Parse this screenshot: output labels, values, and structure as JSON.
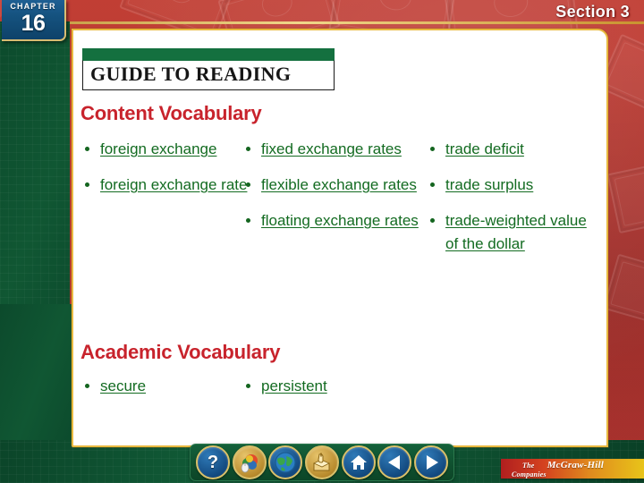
{
  "chapter_badge": {
    "label": "CHAPTER",
    "number": "16"
  },
  "header": {
    "section_title": "Section 3"
  },
  "guide_box": {
    "title": "GUIDE TO READING"
  },
  "content_vocabulary": {
    "heading": "Content Vocabulary",
    "columns": [
      {
        "terms": [
          "foreign exchange",
          "foreign exchange rate"
        ]
      },
      {
        "terms": [
          "fixed exchange rates",
          "flexible exchange rates",
          "floating exchange rates"
        ]
      },
      {
        "terms": [
          "trade deficit",
          "trade surplus",
          "trade-weighted value of the dollar"
        ]
      }
    ]
  },
  "academic_vocabulary": {
    "heading": "Academic Vocabulary",
    "columns": [
      {
        "terms": [
          "secure"
        ]
      },
      {
        "terms": [
          "persistent"
        ]
      }
    ]
  },
  "toolbar": {
    "buttons": [
      {
        "name": "help",
        "glyph": "?"
      },
      {
        "name": "resources",
        "glyph": ""
      },
      {
        "name": "globe",
        "glyph": ""
      },
      {
        "name": "hand-click",
        "glyph": ""
      },
      {
        "name": "home",
        "glyph": ""
      },
      {
        "name": "previous",
        "glyph": ""
      },
      {
        "name": "next",
        "glyph": ""
      }
    ]
  },
  "footer": {
    "publisher_prefix": "The ",
    "publisher_name": "McGraw-Hill",
    "publisher_suffix": " Companies"
  },
  "colors": {
    "background_red": "#c0302a",
    "frame_green": "#105733",
    "panel_border_gold": "#e8b93f",
    "heading_red": "#c8232c",
    "term_green": "#136b21",
    "badge_blue": "#15527f"
  }
}
